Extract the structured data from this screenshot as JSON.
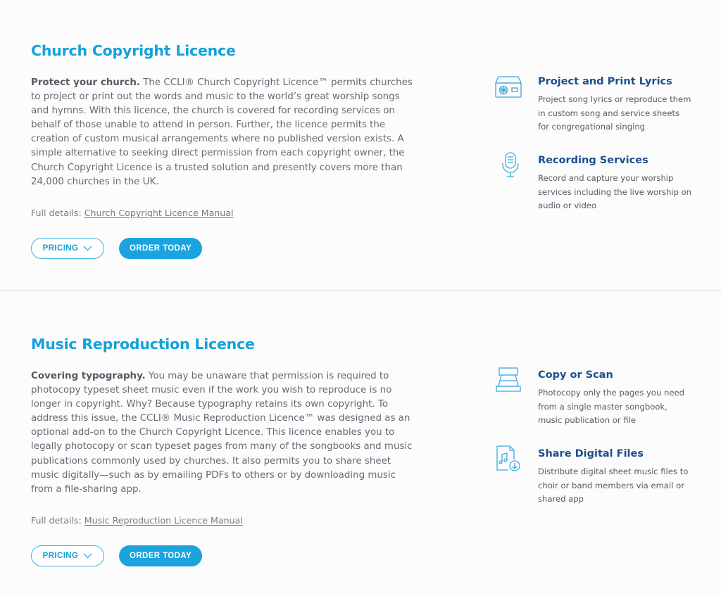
{
  "church_licence": {
    "title": "Church Copyright Licence",
    "lead": "Protect your church.",
    "body": " The CCLI® Church Copyright Licence™ permits churches to project or print out the words and music to the world’s great worship songs and hymns. With this licence, the church is covered for recording services on behalf of those unable to attend in person. Further, the licence permits the creation of custom musical arrangements where no published version exists. A simple alternative to seeking direct permission from each copyright owner, the Church Copyright Licence is a trusted solution and presently covers more than 24,000 churches in the UK.",
    "details_prefix": "Full details: ",
    "details_link": "Church Copyright Licence Manual",
    "pricing_label": "PRICING",
    "order_label": "ORDER TODAY",
    "features": [
      {
        "icon": "projector-icon",
        "title": "Project and Print Lyrics",
        "desc": "Project song lyrics or reproduce them in custom song and service sheets for congregational singing"
      },
      {
        "icon": "microphone-icon",
        "title": "Recording Services",
        "desc": "Record and capture your worship services including the live worship on audio or video"
      }
    ]
  },
  "music_licence": {
    "title": "Music Reproduction Licence",
    "lead": "Covering typography.",
    "body": " You may be unaware that permission is required to photocopy typeset sheet music even if the work you wish to reproduce is no longer in copyright. Why? Because typography retains its own copyright. To address this issue, the CCLI® Music Reproduction Licence™ was designed as an optional add-on to the Church Copyright Licence. This licence enables you to legally photocopy or scan typeset pages from many of the songbooks and music publications commonly used by churches. It also permits you to share sheet music digitally—such as by emailing PDFs to others or by downloading music from a file-sharing app.",
    "details_prefix": "Full details: ",
    "details_link": "Music Reproduction Licence Manual",
    "pricing_label": "PRICING",
    "order_label": "ORDER TODAY",
    "features": [
      {
        "icon": "scanner-icon",
        "title": "Copy or Scan",
        "desc": "Photocopy only the pages you need from a single master songbook, music publication or file"
      },
      {
        "icon": "music-file-download-icon",
        "title": "Share Digital Files",
        "desc": "Distribute digital sheet music files to choir or band members via email or shared app"
      }
    ]
  },
  "colors": {
    "title": "#14a1dc",
    "feature_title": "#1d4f8c",
    "button": "#1aa3de",
    "icon_stroke": "#3aa9dc"
  }
}
